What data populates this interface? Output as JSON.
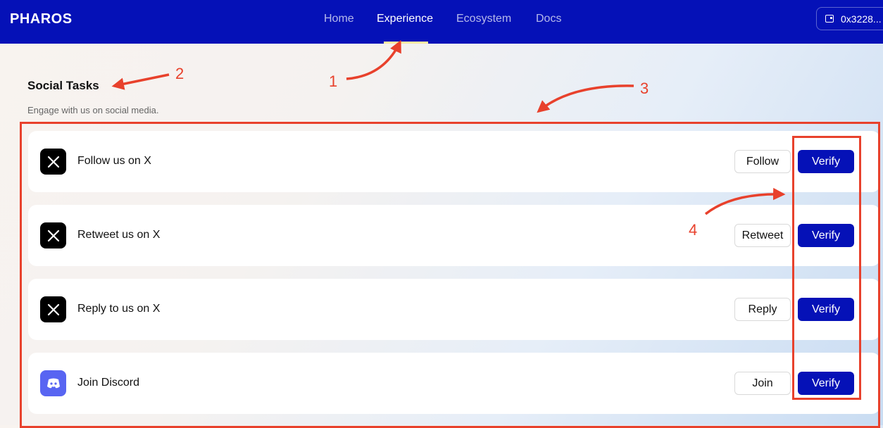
{
  "nav": {
    "logo": "PHAROS",
    "links": [
      "Home",
      "Experience",
      "Ecosystem",
      "Docs"
    ],
    "active": "Experience",
    "wallet": "0x3228..."
  },
  "section": {
    "title": "Social Tasks",
    "subtitle": "Engage with us on social media."
  },
  "tasks": [
    {
      "label": "Follow us on X",
      "action": "Follow",
      "verify": "Verify",
      "icon": "x-logo-icon"
    },
    {
      "label": "Retweet us on X",
      "action": "Retweet",
      "verify": "Verify",
      "icon": "x-logo-icon"
    },
    {
      "label": "Reply to us on X",
      "action": "Reply",
      "verify": "Verify",
      "icon": "x-logo-icon"
    },
    {
      "label": "Join Discord",
      "action": "Join",
      "verify": "Verify",
      "icon": "discord-icon"
    }
  ],
  "annotations": [
    "1",
    "2",
    "3",
    "4"
  ],
  "colors": {
    "brand": "#0511b7",
    "annotation": "#e8412c",
    "discord": "#5865f2"
  }
}
